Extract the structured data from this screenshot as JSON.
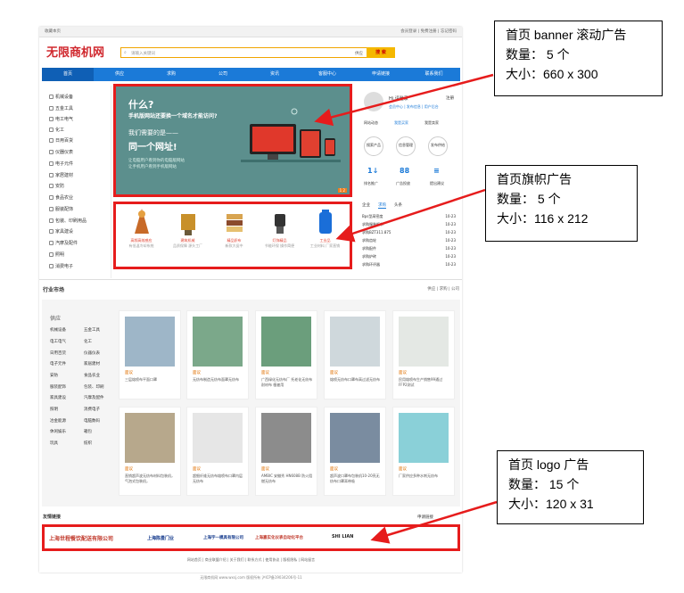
{
  "topbar": {
    "left": "收藏本页",
    "right": "会员登录 | 免费注册 | 忘记密码"
  },
  "logo": "无限商机网",
  "search": {
    "placeholder": "请输入关键词",
    "category": "供应",
    "button": "搜 索"
  },
  "nav": [
    "首页",
    "供应",
    "求购",
    "公司",
    "资讯",
    "客服中心",
    "申请链接",
    "联系我们"
  ],
  "sidebar": [
    "机械设备",
    "五金工具",
    "电工电气",
    "化工",
    "日用百货",
    "仪器仪表",
    "电子元件",
    "家居建材",
    "安防",
    "食品农业",
    "服装配饰",
    "包装、印刷用品",
    "家具建设",
    "汽摩及配件",
    "照明",
    "消费电子"
  ],
  "banner": {
    "line1": "什么?",
    "line2": "手机版网站还要换一个域名才能访问?",
    "line3": "我们需要的是——",
    "line4": "同一个网址!",
    "line5": "让电脑用户看到你的电脑版网站",
    "line6": "让手机用户看到手机版网站",
    "pager": "1 2"
  },
  "banner_products": [
    {
      "name": "高频高效感应",
      "desc": "有低温冷却系统",
      "color": "#c86a28"
    },
    {
      "name": "建筑机械",
      "desc": "品质保障 源头工厂",
      "color": "#c8902a"
    },
    {
      "name": "精品织布",
      "desc": "新款大促中",
      "color": "#d8a450"
    },
    {
      "name": "灯饰精品",
      "desc": "节能环保 操作简便",
      "color": "#333333"
    },
    {
      "name": "工业品",
      "desc": "工业材料 厂家直销",
      "color": "#1a6ed8"
    }
  ],
  "right_panel": {
    "greeting": "Hi,请登录",
    "register": "注册",
    "links": "会员中心 | 发布信息 | 用户后台",
    "tabs": [
      "网站动态",
      "我是买家",
      "我是卖家"
    ],
    "circles": [
      "搜索产品",
      "信息管理",
      "发布供给"
    ],
    "icons": [
      {
        "label": "排名推广",
        "glyph": "1↓"
      },
      {
        "label": "广告投放",
        "glyph": "88"
      },
      {
        "label": "提出建议",
        "glyph": "≡"
      }
    ],
    "news_tabs": [
      "企业",
      "求购",
      "头条"
    ],
    "news": [
      {
        "t": "Bps型高密度",
        "d": "10-23"
      },
      {
        "t": "求购服装框节",
        "d": "10-23"
      },
      {
        "t": "求购BZT311.875",
        "d": "10-23"
      },
      {
        "t": "求购齿轮",
        "d": "10-23"
      },
      {
        "t": "求购配件",
        "d": "10-23"
      },
      {
        "t": "求购炉砖",
        "d": "10-23"
      },
      {
        "t": "求购环评器",
        "d": "10-23"
      }
    ]
  },
  "market": {
    "title": "行业市场",
    "tabs": "供应 | 求购 | 公司",
    "side_title": "供应",
    "categories": [
      [
        "机械设备",
        "五金工具"
      ],
      [
        "电工电气",
        "化工"
      ],
      [
        "日用百货",
        "仪器仪表"
      ],
      [
        "电子元件",
        "家居建材"
      ],
      [
        "安防",
        "食品农业"
      ],
      [
        "服装配饰",
        "包装、印刷"
      ],
      [
        "家具建设",
        "汽摩及配件"
      ],
      [
        "照明",
        "消费电子"
      ],
      [
        "冶金能源",
        "电脑数码"
      ],
      [
        "休闲娱乐",
        "箱包"
      ],
      [
        "玩具",
        "纺织"
      ]
    ],
    "cards": [
      {
        "tag": "面议",
        "text": "三层熔喷布平面口罩",
        "color": "#9eb6c8"
      },
      {
        "tag": "面议",
        "text": "无纺布制造无纺布面罩无纺布",
        "color": "#7ba88a"
      },
      {
        "tag": "面议",
        "text": "广西绿化无纺布厂 托老化无纺布 耐材布 植被用",
        "color": "#6b9e7c"
      },
      {
        "tag": "面议",
        "text": "熔喷无纺布口罩布高过滤无纺布",
        "color": "#cfd8dc"
      },
      {
        "tag": "面议",
        "text": "民用熔喷布生产销售99通过FFP2测试",
        "color": "#e4e8e4"
      },
      {
        "tag": "面议",
        "text": "直销超声波无纺布材料包装机，气泡式包装机，",
        "color": "#b7a88c"
      },
      {
        "tag": "面议",
        "text": "超细纤维无纺布熔喷布口罩内层无纺布",
        "color": "#e6e6e6"
      },
      {
        "tag": "面议",
        "text": "AMBIC 安徽秀 HN608B 防火阻燃无纺布",
        "color": "#8c8c8c"
      },
      {
        "tag": "面议",
        "text": "超声波口罩布包装机10-20亮无纺布口罩耳带吸",
        "color": "#7a8ca0"
      },
      {
        "tag": "面议",
        "text": "厂家供应多种水刺无纺布",
        "color": "#8ad0d8"
      }
    ]
  },
  "friend_links": {
    "title": "友情链接",
    "apply": "申请链接"
  },
  "partner_logos": [
    {
      "text": "上海世程餐饮配送有限公司",
      "color": "#c0392b"
    },
    {
      "text": "上海陈曼门业",
      "color": "#1a3f8f"
    },
    {
      "text": "上海宇一模具有限公司",
      "color": "#1a3f8f"
    },
    {
      "text": "上海嘉实化仪表自动化平台",
      "color": "#c0392b"
    },
    {
      "text": "SHI LIAN",
      "color": "#222222"
    }
  ],
  "footer": {
    "links": "网站首页 | 商业联盟介绍 | 关于我们 | 联系方式 | 使用协议 | 版权隐私 | 网站留言",
    "copyright": "无限商机网 www.wxsj.com 版权所有 沪ICP备19034206号-11"
  },
  "callouts": {
    "banner": [
      "首页 banner 滚动广告",
      "数量：  5 个",
      "大小：660 x 300"
    ],
    "flag": [
      "首页旗帜广告",
      "数量：  5 个",
      "大小：116 x 212"
    ],
    "logo": [
      "首页 logo 广告",
      "数量：  15 个",
      "大小：120 x 31"
    ]
  },
  "colors": {
    "accent_red": "#e61c1c",
    "nav_blue": "#1b7ad8",
    "brand_red": "#d0282e",
    "search_yellow": "#f5b800"
  }
}
